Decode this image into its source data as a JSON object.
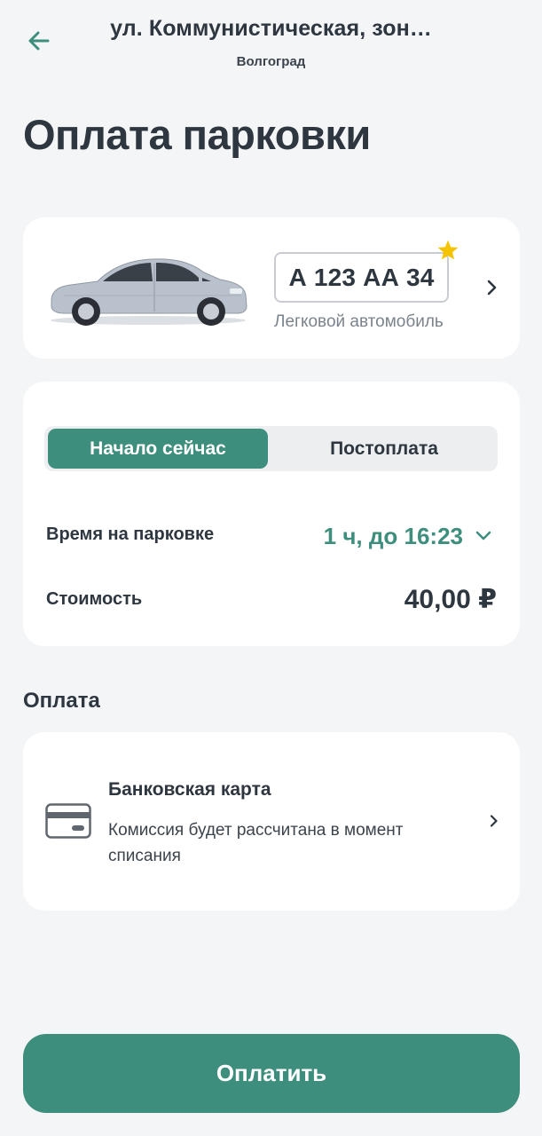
{
  "header": {
    "title": "ул. Коммунистическая, зон…",
    "subtitle": "Волгоград"
  },
  "page_title": "Оплата парковки",
  "vehicle": {
    "plate": "А 123 АА 34",
    "type": "Легковой автомобиль",
    "favorite": true
  },
  "parking": {
    "tabs": [
      "Начало сейчас",
      "Постоплата"
    ],
    "active_tab": 0,
    "time_label": "Время на парковке",
    "time_value": "1 ч, до 16:23",
    "cost_label": "Стоимость",
    "cost_value": "40,00 ₽"
  },
  "payment": {
    "section_label": "Оплата",
    "method_title": "Банковская карта",
    "method_description": "Комиссия будет рассчитана в момент списания"
  },
  "pay_button_label": "Оплатить",
  "colors": {
    "accent": "#3e8e7e",
    "star": "#f5c400",
    "background": "#f4f5f7"
  },
  "icons": {
    "back": "arrow-left-icon",
    "star": "star-icon",
    "forward": "chevron-right-icon",
    "dropdown": "chevron-down-icon",
    "card": "credit-card-icon"
  }
}
